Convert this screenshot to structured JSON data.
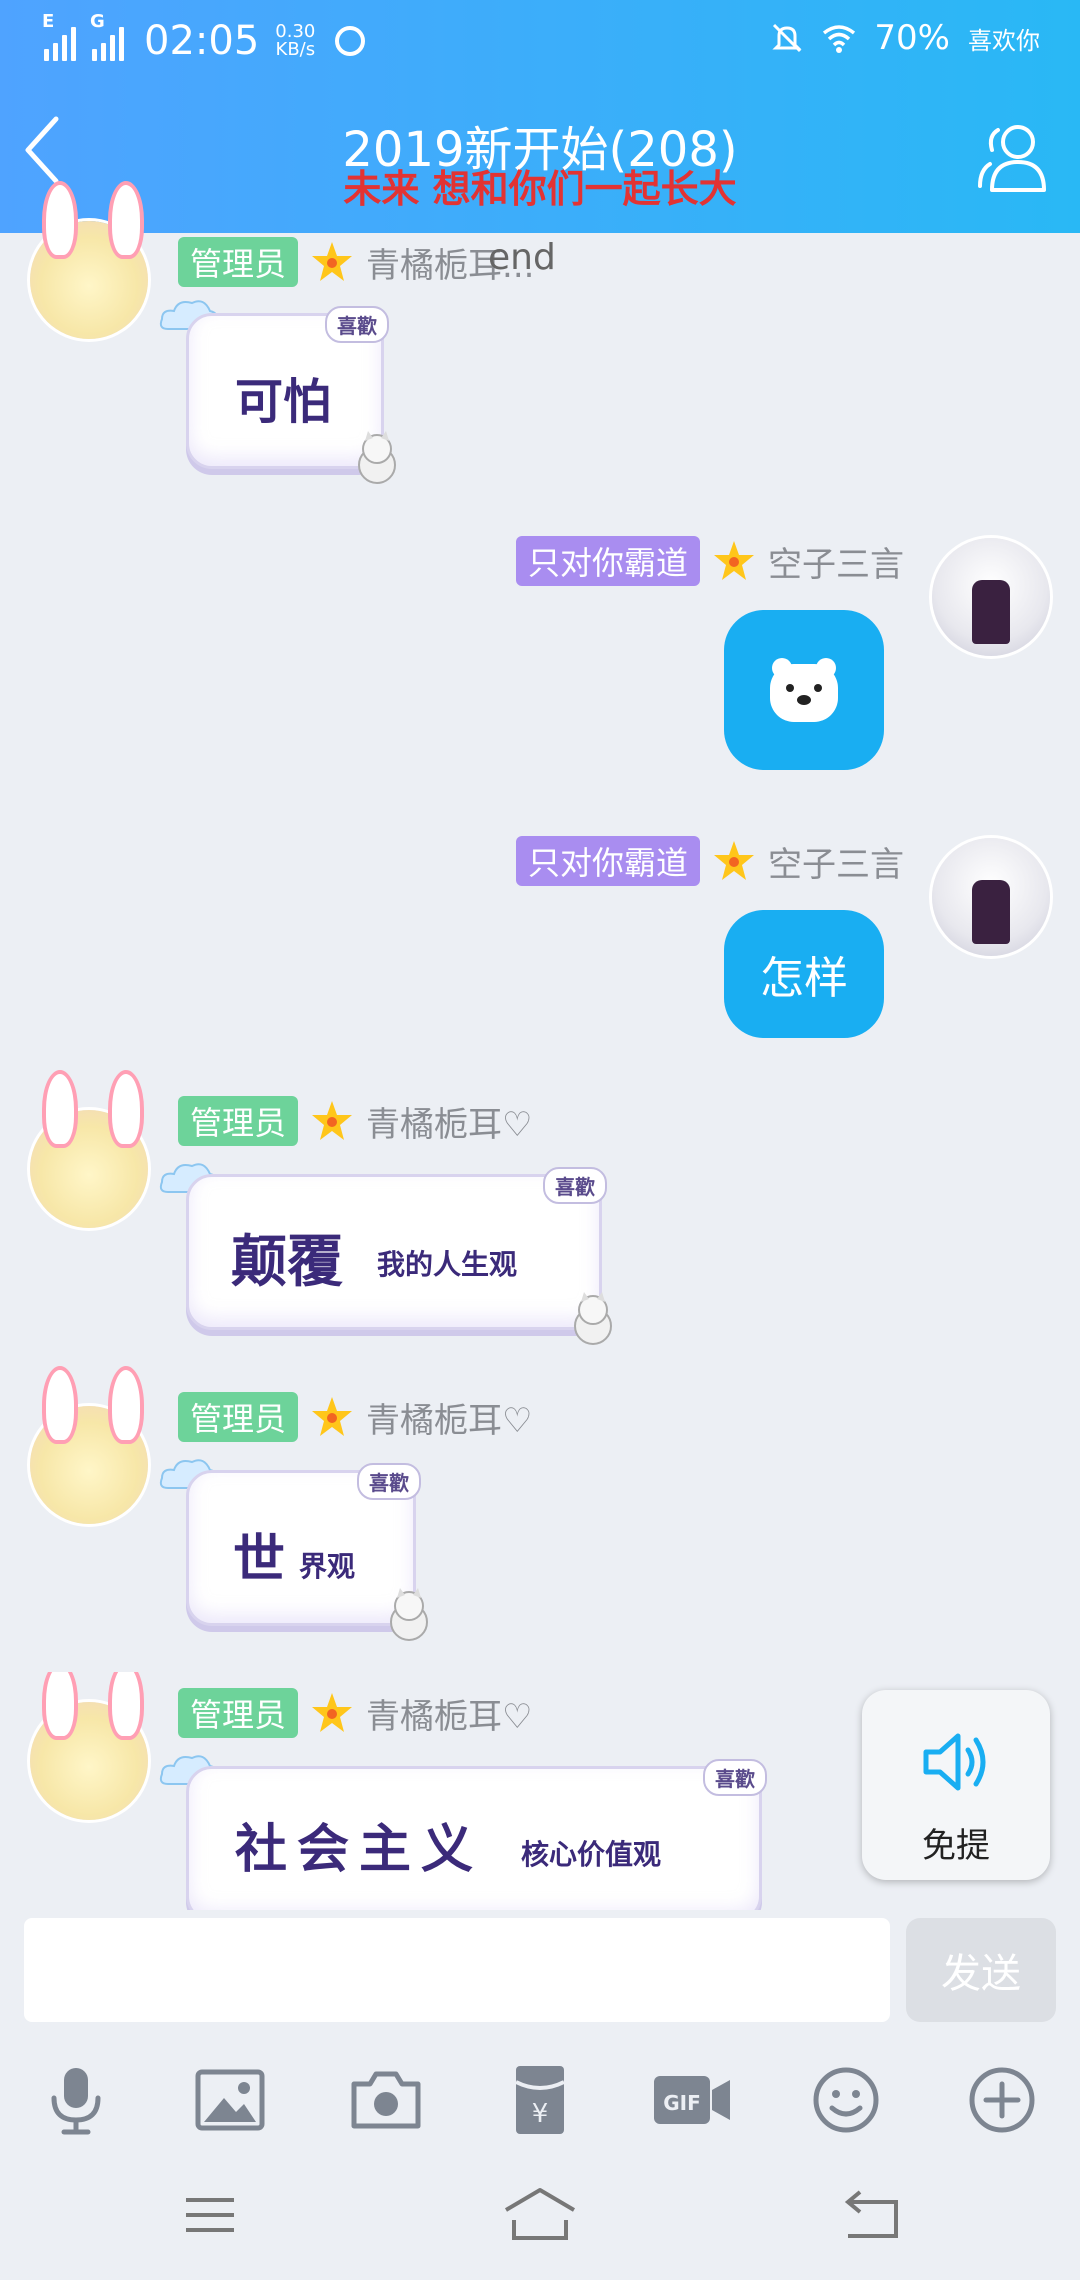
{
  "status_bar": {
    "net1": "E",
    "net2": "G",
    "time": "02:05",
    "speed_value": "0.30",
    "speed_unit": "KB/s",
    "battery": "70%",
    "slogan": "喜欢你"
  },
  "header": {
    "title": "2019新开始(208)",
    "subtitle": "未来 想和你们一起长大",
    "colors": {
      "start": "#4fa3ff",
      "end": "#29b8f5"
    }
  },
  "messages": [
    {
      "side": "left",
      "role": "管理员",
      "nick": "青橘栀耳...",
      "overlay": "end",
      "sticker_main": "可怕",
      "sticker_small": "",
      "like": "喜歡"
    },
    {
      "side": "right",
      "role": "只对你霸道",
      "nick": "空子三言",
      "content": "bear-emoji"
    },
    {
      "side": "right",
      "role": "只对你霸道",
      "nick": "空子三言",
      "text": "怎样"
    },
    {
      "side": "left",
      "role": "管理员",
      "nick": "青橘栀耳♡",
      "sticker_main": "颠覆",
      "sticker_small": "我的人生观",
      "like": "喜歡"
    },
    {
      "side": "left",
      "role": "管理员",
      "nick": "青橘栀耳♡",
      "sticker_main": "世",
      "sticker_small": "界观",
      "like": "喜歡"
    },
    {
      "side": "left",
      "role": "管理员",
      "nick": "青橘栀耳♡",
      "sticker_main": "社会主义",
      "sticker_small": "核心价值观",
      "like": "喜歡"
    }
  ],
  "colors": {
    "admin_badge": "#6dd39a",
    "vip_badge": "#a98df0",
    "right_bubble": "#19aef2"
  },
  "float_button": {
    "label": "免提",
    "icon": "speaker-icon"
  },
  "input": {
    "placeholder": "",
    "send_label": "发送"
  },
  "toolbar": [
    "mic-icon",
    "image-icon",
    "camera-icon",
    "red-packet-icon",
    "gif-icon",
    "emoji-icon",
    "plus-icon"
  ],
  "nav": [
    "menu-icon",
    "home-icon",
    "back-icon"
  ]
}
